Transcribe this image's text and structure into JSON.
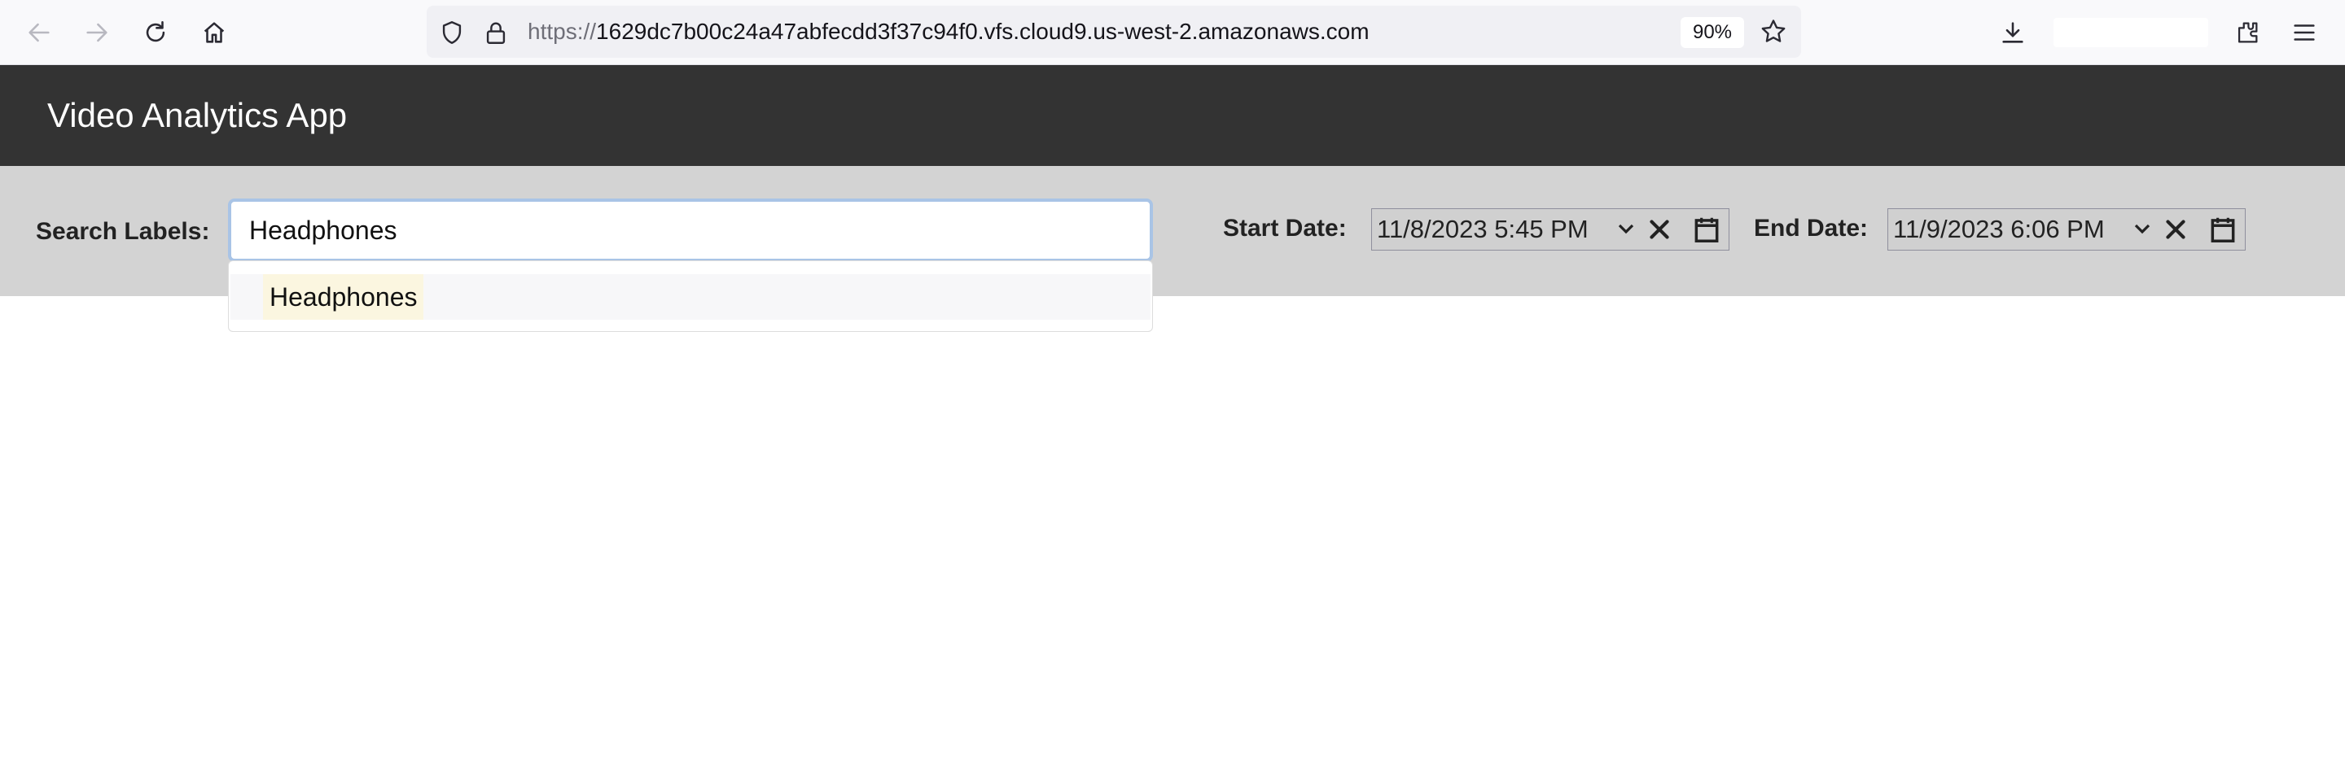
{
  "browser": {
    "url_scheme": "https://",
    "url_host": "1629dc7b00c24a47abfecdd3f37c94f0.vfs.cloud9.us-west-2.amazonaws.com",
    "zoom": "90%",
    "icons": [
      "back-icon",
      "forward-icon",
      "reload-icon",
      "home-icon",
      "shield-icon",
      "lock-icon",
      "star-icon",
      "download-icon",
      "extensions-icon",
      "menu-icon"
    ]
  },
  "app": {
    "title": "Video Analytics App"
  },
  "search": {
    "label": "Search Labels:",
    "value": "Headphones",
    "suggestions": [
      "Headphones"
    ]
  },
  "start_date": {
    "label": "Start Date:",
    "value": "11/8/2023  5:45  PM"
  },
  "end_date": {
    "label": "End Date:",
    "value": "11/9/2023  6:06  PM"
  },
  "colors": {
    "header_bg": "#333333",
    "toolbar_bg": "#d3d3d3",
    "focus_ring": "#a9c4e6"
  }
}
